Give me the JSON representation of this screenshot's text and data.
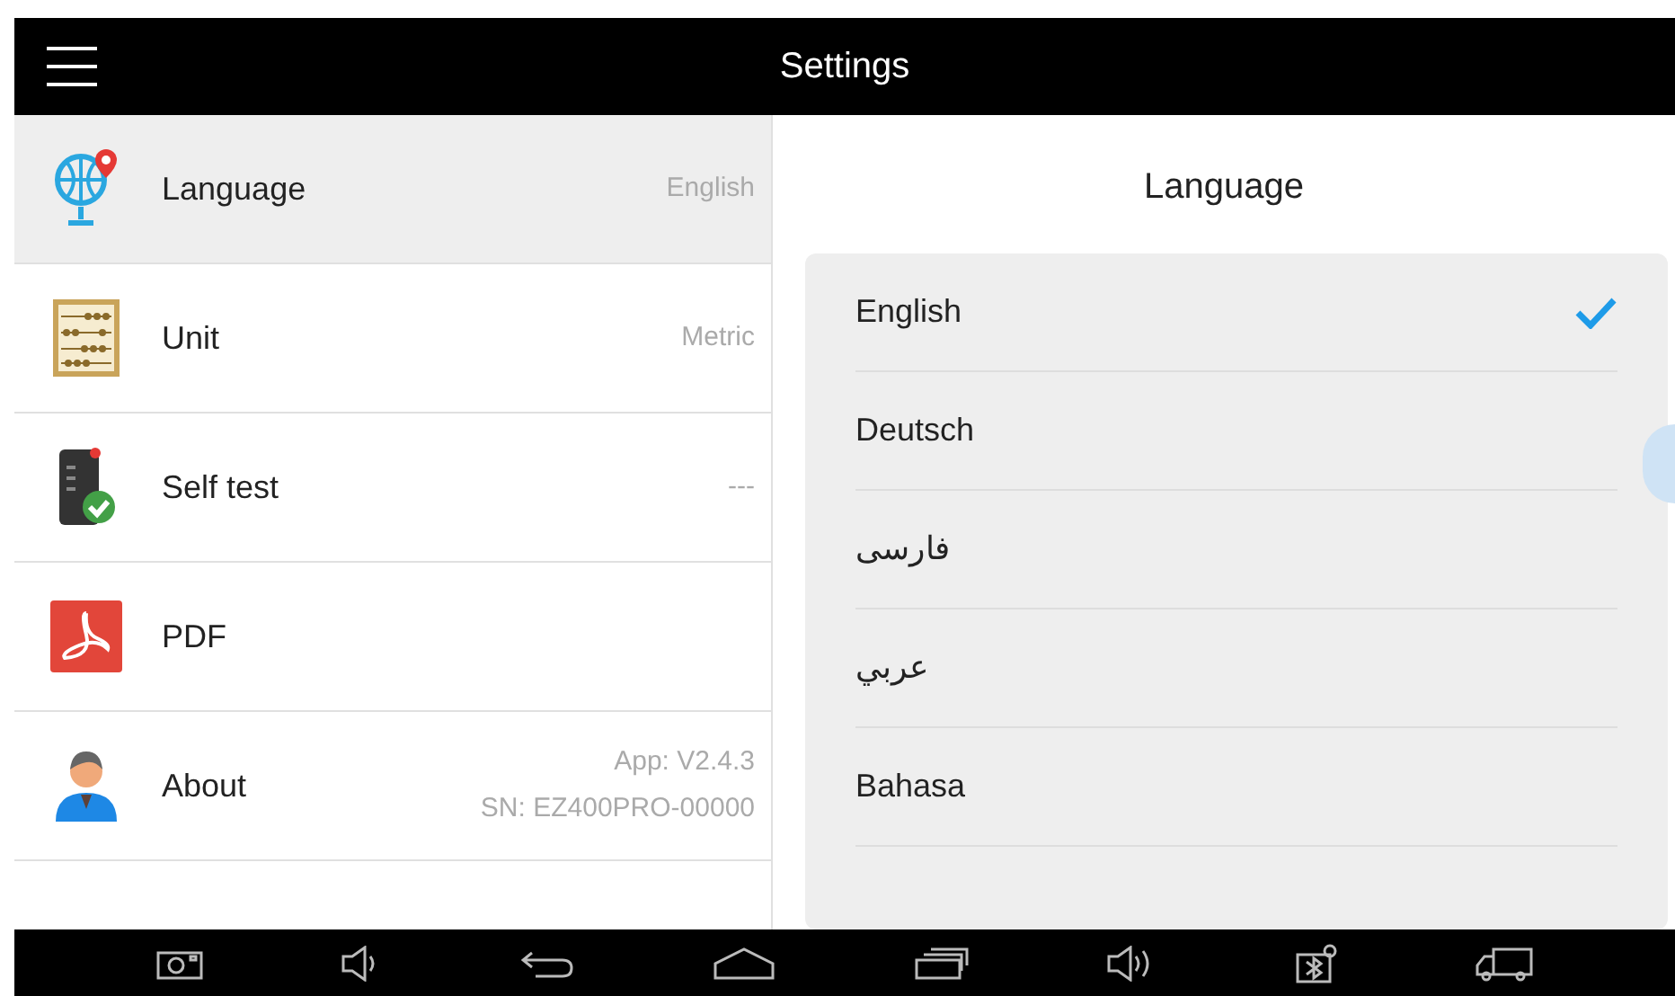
{
  "title_bar": {
    "title": "Settings"
  },
  "settings": [
    {
      "label": "Language",
      "value": [
        "English"
      ],
      "selected": true
    },
    {
      "label": "Unit",
      "value": [
        "Metric"
      ],
      "selected": false
    },
    {
      "label": "Self test",
      "value": [
        "---"
      ],
      "selected": false
    },
    {
      "label": "PDF",
      "selected": false
    },
    {
      "label": "About",
      "value": [
        "App: V2.4.3",
        "SN: EZ400PRO-00000"
      ],
      "selected": false
    }
  ],
  "detail": {
    "title": "Language",
    "languages": [
      {
        "label": "English",
        "selected": true
      },
      {
        "label": "Deutsch",
        "selected": false
      },
      {
        "label": "فارسی",
        "selected": false
      },
      {
        "label": "عربي",
        "selected": false
      },
      {
        "label": "Bahasa",
        "selected": false
      }
    ]
  }
}
